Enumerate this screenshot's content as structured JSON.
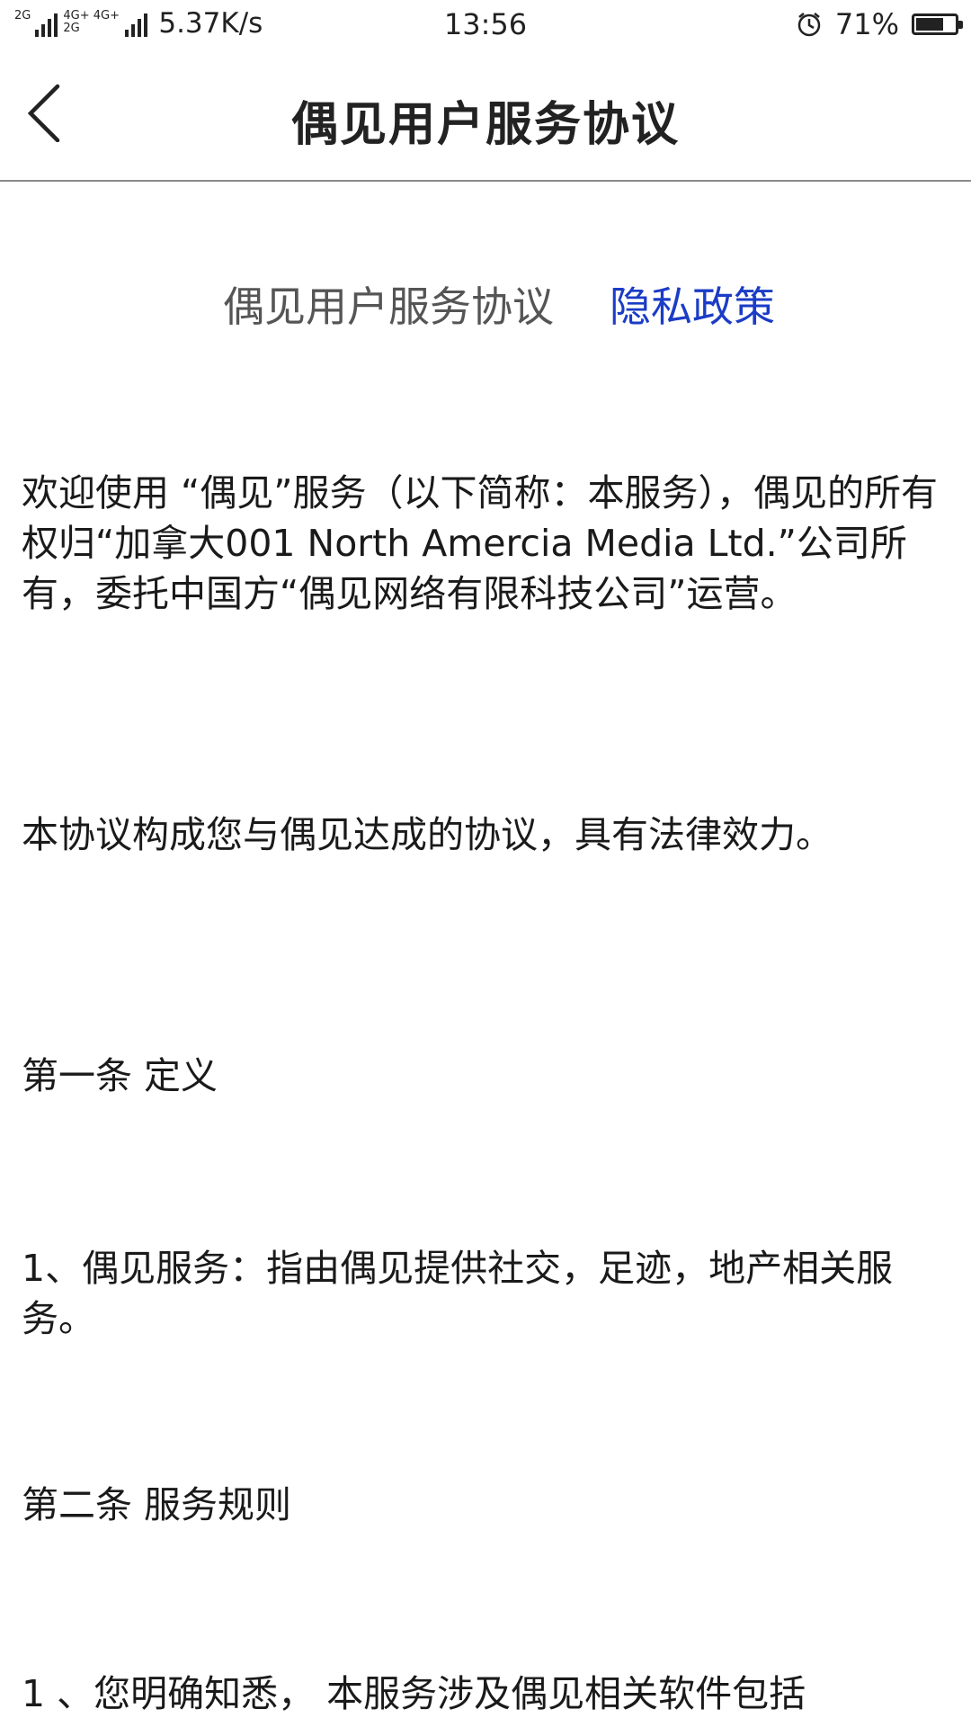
{
  "status_bar": {
    "signal1_label": "2G",
    "signal2_label": "4G+ 4G+ 2G",
    "net_speed": "5.37K/s",
    "time": "13:56",
    "battery_percent": "71%",
    "battery_level": 0.71,
    "icons": [
      "signal-icon",
      "alarm-icon",
      "battery-icon"
    ]
  },
  "nav": {
    "title": "偶见用户服务协议",
    "back_icon": "chevron-left-icon"
  },
  "tabs": [
    {
      "label": "偶见用户服务协议",
      "active": true
    },
    {
      "label": "隐私政策",
      "active": false
    }
  ],
  "colors": {
    "link_blue": "#1b3cc6",
    "divider": "#8a8a8a"
  },
  "content": {
    "p1": "  欢迎使用 “偶见”服务（以下简称：本服务），偶见的所有权归“加拿大001 North Amercia Media Ltd.”公司所有，委托中国方“偶见网络有限科技公司”运营。",
    "p2": "本协议构成您与偶见达成的协议，具有法律效力。",
    "p3": "第一条 定义",
    "p4": "1、偶见服务：指由偶见提供社交，足迹，地产相关服务。",
    "p5": "第二条 服务规则",
    "p6": "1 、您明确知悉， 本服务涉及偶见相关软件包括"
  }
}
